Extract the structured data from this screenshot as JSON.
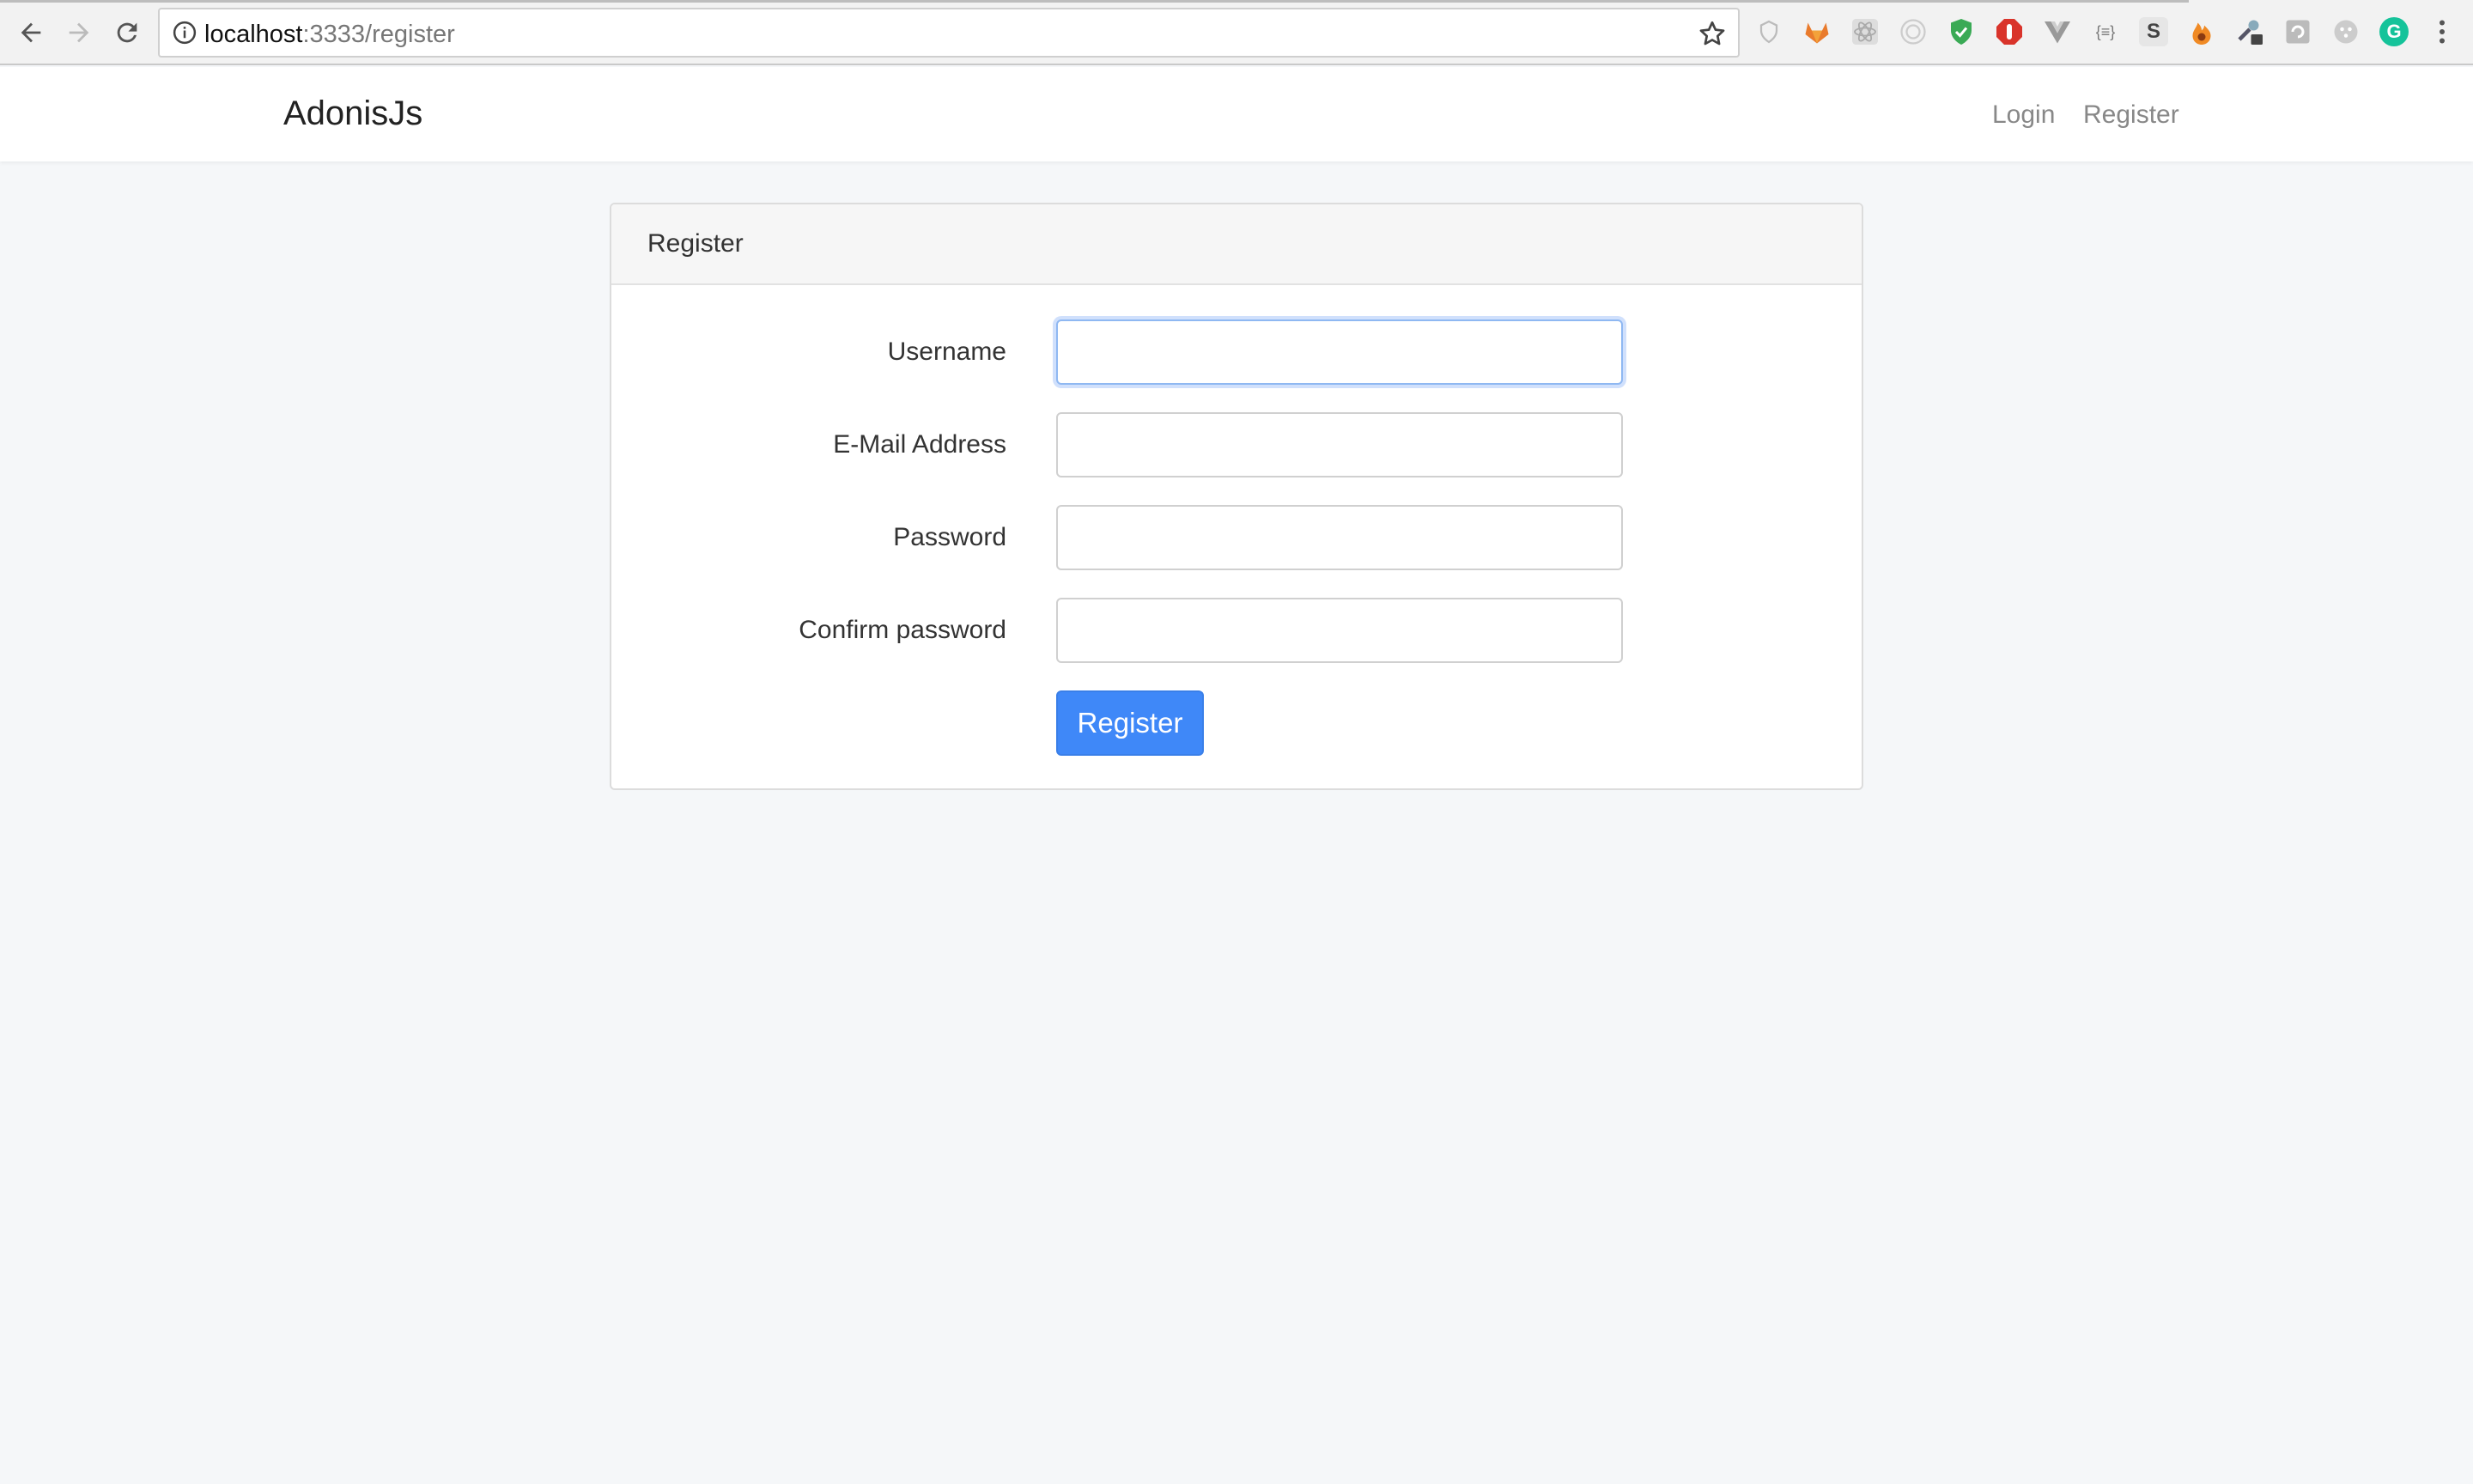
{
  "browser": {
    "url_host": "localhost",
    "url_path": ":3333/register",
    "load_progress": 0.885,
    "extensions": [
      "shield-outline-icon",
      "gitlab-fox-icon",
      "react-atom-icon",
      "target-circle-icon",
      "green-shield-check-icon",
      "red-octagon-icon",
      "vue-v-icon",
      "json-braces-icon",
      "s-badge-icon",
      "fire-icon",
      "wrench-lock-icon",
      "grey-refresh-square-icon",
      "grey-dots-circle-icon",
      "grammarly-icon"
    ],
    "json_ext_text": "{≡}",
    "s_ext_text": "S",
    "grammarly_text": "G"
  },
  "navbar": {
    "brand": "AdonisJs",
    "links": [
      {
        "label": "Login"
      },
      {
        "label": "Register"
      }
    ]
  },
  "card": {
    "title": "Register",
    "fields": [
      {
        "label": "Username",
        "value": "",
        "focused": true
      },
      {
        "label": "E-Mail Address",
        "value": ""
      },
      {
        "label": "Password",
        "value": ""
      },
      {
        "label": "Confirm password",
        "value": ""
      }
    ],
    "submit_label": "Register"
  },
  "colors": {
    "primary": "#3f88f8",
    "background": "#f5f7f9",
    "focus_ring": "#8fb8f2"
  }
}
